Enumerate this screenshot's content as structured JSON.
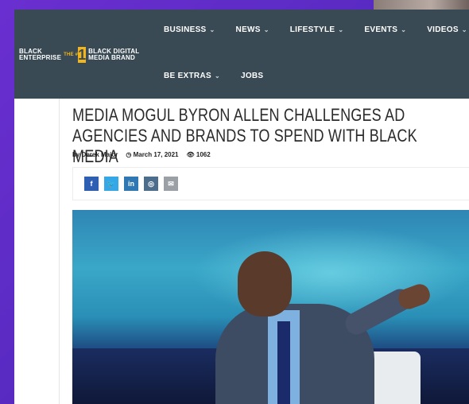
{
  "nav": {
    "logo": {
      "left_line1": "BLACK",
      "left_line2": "ENTERPRISE",
      "the": "THE #",
      "number": "1",
      "right_line1": "BLACK DIGITAL",
      "right_line2": "MEDIA BRAND"
    },
    "items_row1": [
      {
        "label": "BUSINESS",
        "chev": "⌄"
      },
      {
        "label": "NEWS",
        "chev": "⌄"
      },
      {
        "label": "LIFESTYLE",
        "chev": "⌄"
      },
      {
        "label": "EVENTS",
        "chev": "⌄"
      },
      {
        "label": "VIDEOS",
        "chev": "⌄"
      }
    ],
    "items_row2": [
      {
        "label": "BE EXTRAS",
        "chev": "⌄"
      },
      {
        "label": "JOBS",
        "chev": ""
      }
    ]
  },
  "article": {
    "title": "MEDIA MOGUL BYRON ALLEN CHALLENGES AD AGENCIES AND BRANDS TO SPEND WITH BLACK MEDIA",
    "author": "by Derek Major",
    "date": "March 17, 2021",
    "views": "1062",
    "date_icon": "clock-icon",
    "views_icon": "eye-icon"
  },
  "share": [
    {
      "label": "f",
      "icon": "facebook-icon"
    },
    {
      "label": "🐦",
      "icon": "twitter-icon"
    },
    {
      "label": "in",
      "icon": "linkedin-icon"
    },
    {
      "label": "◎",
      "icon": "instagram-icon"
    },
    {
      "label": "✉",
      "icon": "email-icon"
    }
  ],
  "colors": {
    "nav_bg": "#3a4a55",
    "background": "#5b2bc4",
    "logo_accent": "#f2b51c"
  }
}
